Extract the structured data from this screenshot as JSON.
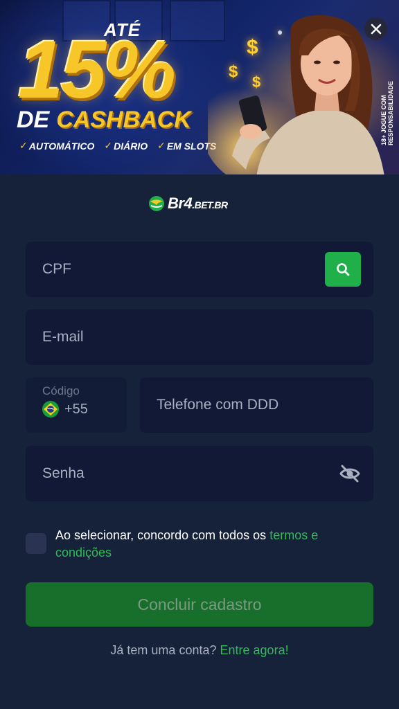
{
  "banner": {
    "ate": "ATÉ",
    "percent": "15%",
    "de": "DE",
    "cashback": "CASHBACK",
    "features": [
      "AUTOMÁTICO",
      "DIÁRIO",
      "EM SLOTS"
    ],
    "age_notice": "18+ JOGUE COM RESPONSABILIDADE",
    "close_icon": "close-icon"
  },
  "logo": {
    "main": "Br4",
    "suffix": ".BET.BR"
  },
  "form": {
    "cpf_placeholder": "CPF",
    "email_placeholder": "E-mail",
    "code_label": "Código",
    "code_value": "+55",
    "phone_placeholder": "Telefone com DDD",
    "password_placeholder": "Senha",
    "terms_text": "Ao selecionar, concordo com todos os ",
    "terms_link": "termos e condições",
    "submit_label": "Concluir cadastro",
    "login_prompt": "Já tem uma conta?",
    "login_link": "Entre agora!"
  },
  "colors": {
    "background": "#16213a",
    "field": "#111936",
    "accent_green": "#1fb04a",
    "submit_green": "#186e2b",
    "link_green": "#2dbd53",
    "gold": "#f7c72a"
  }
}
